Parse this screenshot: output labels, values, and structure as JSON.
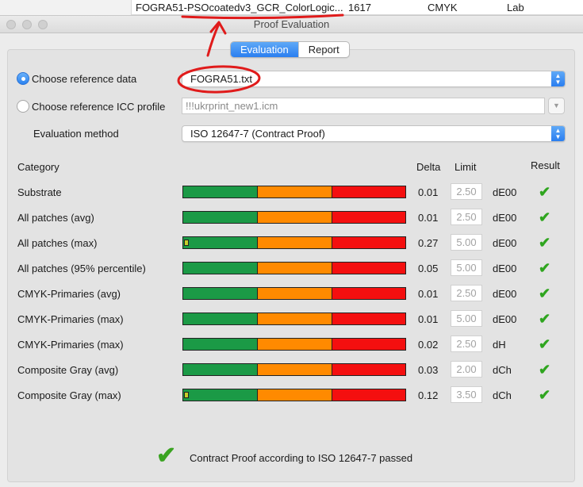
{
  "background_table": {
    "name": "FOGRA51-PSOcoatedv3_GCR_ColorLogic...",
    "count": "1617",
    "colorspace": "CMYK",
    "pcs": "Lab"
  },
  "window": {
    "title": "Proof Evaluation"
  },
  "tabs": [
    {
      "label": "Evaluation",
      "active": true
    },
    {
      "label": "Report",
      "active": false
    }
  ],
  "reference": {
    "data_label": "Choose reference data",
    "data_value": "FOGRA51.txt",
    "icc_label": "Choose reference ICC profile",
    "icc_value": "!!!ukrprint_new1.icm",
    "method_label": "Evaluation method",
    "method_value": "ISO 12647-7 (Contract Proof)"
  },
  "table": {
    "headers": {
      "category": "Category",
      "delta": "Delta",
      "limit": "Limit",
      "result": "Result"
    },
    "rows": [
      {
        "category": "Substrate",
        "delta": "0.01",
        "limit": "2.50",
        "unit": "dE00",
        "indicator": false
      },
      {
        "category": "All patches (avg)",
        "delta": "0.01",
        "limit": "2.50",
        "unit": "dE00",
        "indicator": false
      },
      {
        "category": "All patches (max)",
        "delta": "0.27",
        "limit": "5.00",
        "unit": "dE00",
        "indicator": true
      },
      {
        "category": "All patches (95% percentile)",
        "delta": "0.05",
        "limit": "5.00",
        "unit": "dE00",
        "indicator": false
      },
      {
        "category": "CMYK-Primaries (avg)",
        "delta": "0.01",
        "limit": "2.50",
        "unit": "dE00",
        "indicator": false
      },
      {
        "category": "CMYK-Primaries (max)",
        "delta": "0.01",
        "limit": "5.00",
        "unit": "dE00",
        "indicator": false
      },
      {
        "category": "CMYK-Primaries (max)",
        "delta": "0.02",
        "limit": "2.50",
        "unit": "dH",
        "indicator": false
      },
      {
        "category": "Composite Gray (avg)",
        "delta": "0.03",
        "limit": "2.00",
        "unit": "dCh",
        "indicator": false
      },
      {
        "category": "Composite Gray (max)",
        "delta": "0.12",
        "limit": "3.50",
        "unit": "dCh",
        "indicator": true
      }
    ]
  },
  "footer": {
    "message": "Contract Proof according to ISO 12647-7 passed"
  },
  "icons": {
    "check": "✔",
    "popup_arrows": "▲▼",
    "chevron": "⌄"
  },
  "colors": {
    "accent": "#2a7ef0",
    "bar_green": "#1b9a46",
    "bar_orange": "#ff8a00",
    "bar_red": "#f40f0f",
    "pass_check": "#2fa51f",
    "annotation": "#e01b1b"
  }
}
